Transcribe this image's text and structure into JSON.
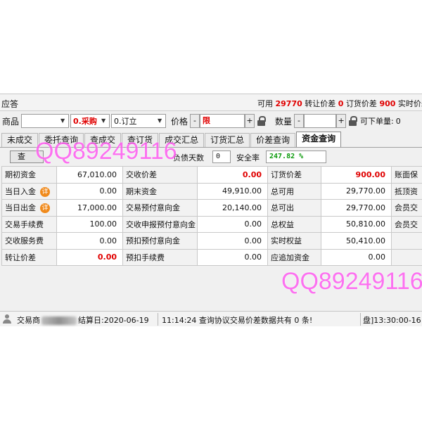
{
  "topbar": {
    "title": "应答",
    "available_label": "可用",
    "available_value": "29770",
    "transfer_label": "转让价差",
    "transfer_value": "0",
    "order_label": "订货价差",
    "order_value": "900",
    "realtime_label": "实时价差"
  },
  "orderbar": {
    "product_label": "商品",
    "product_value": "",
    "type_value": "0.采购",
    "order_type_value": "0.订立",
    "price_label": "价格",
    "price_minus": "-",
    "price_value": "限",
    "price_plus": "+",
    "qty_label": "数量",
    "qty_minus": "-",
    "qty_value": "",
    "qty_plus": "+",
    "max_label": "可下单量:",
    "max_value": "0"
  },
  "tabs": [
    "未成交",
    "委托查询",
    "查成交",
    "查订货",
    "成交汇总",
    "订货汇总",
    "价差查询",
    "资金查询"
  ],
  "subbar": {
    "query_button": "查",
    "debt_days_label": "负债天数",
    "debt_days_value": "0",
    "safety_label": "安全率",
    "safety_value": "247.82 %"
  },
  "fund_rows": [
    [
      {
        "label": "期初资金",
        "value": "67,010.00",
        "red": false,
        "badge": ""
      },
      {
        "label": "交收价差",
        "value": "0.00",
        "red": true,
        "badge": ""
      },
      {
        "label": "订货价差",
        "value": "900.00",
        "red": true,
        "badge": ""
      },
      {
        "label": "账面保"
      }
    ],
    [
      {
        "label": "当日入金",
        "value": "0.00",
        "red": false,
        "badge": "详"
      },
      {
        "label": "期末资金",
        "value": "49,910.00",
        "red": false,
        "badge": ""
      },
      {
        "label": "总可用",
        "value": "29,770.00",
        "red": false,
        "badge": ""
      },
      {
        "label": "抵顶资"
      }
    ],
    [
      {
        "label": "当日出金",
        "value": "17,000.00",
        "red": false,
        "badge": "详"
      },
      {
        "label": "交易预付意向金",
        "value": "20,140.00",
        "red": false,
        "badge": ""
      },
      {
        "label": "总可出",
        "value": "29,770.00",
        "red": false,
        "badge": ""
      },
      {
        "label": "会员交"
      }
    ],
    [
      {
        "label": "交易手续费",
        "value": "100.00",
        "red": false,
        "badge": ""
      },
      {
        "label": "交收申报预付意向金",
        "value": "0.00",
        "red": false,
        "badge": ""
      },
      {
        "label": "总权益",
        "value": "50,810.00",
        "red": false,
        "badge": ""
      },
      {
        "label": "会员交"
      }
    ],
    [
      {
        "label": "交收服务费",
        "value": "0.00",
        "red": false,
        "badge": ""
      },
      {
        "label": "预扣预付意向金",
        "value": "0.00",
        "red": false,
        "badge": ""
      },
      {
        "label": "实时权益",
        "value": "50,410.00",
        "red": false,
        "badge": ""
      },
      {
        "label": ""
      }
    ],
    [
      {
        "label": "转让价差",
        "value": "0.00",
        "red": true,
        "badge": ""
      },
      {
        "label": "预扣手续费",
        "value": "0.00",
        "red": false,
        "badge": ""
      },
      {
        "label": "应追加资金",
        "value": "0.00",
        "red": false,
        "badge": ""
      },
      {
        "label": ""
      }
    ]
  ],
  "statusbar": {
    "trader_label": "交易商",
    "settle_text": "结算日:2020-06-19",
    "message": "11:14:24 查询协议交易价差数据共有 0 条!",
    "session": "盘]13:30:00-16"
  },
  "watermarks": [
    "QQ89249116",
    "QQ89249116"
  ],
  "colors": {
    "accent_red": "#e00000",
    "safety_green": "#0b9a0b",
    "badge_orange": "#f08a1c",
    "watermark_pink": "#ff5cf0"
  }
}
